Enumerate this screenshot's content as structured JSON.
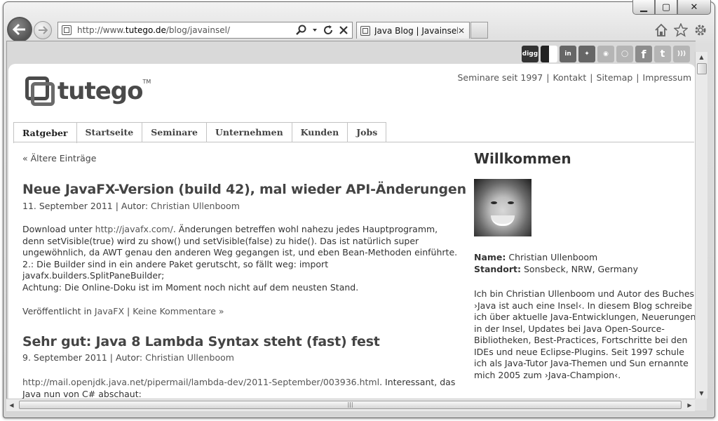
{
  "browser": {
    "url_prefix": "http://www.",
    "url_domain": "tutego.de",
    "url_suffix": "/blog/javainsel/",
    "tab_title": "Java Blog | Javainsel...",
    "tab_close": "✕",
    "caption_minimize": "▁",
    "caption_maximize": "▢",
    "caption_close": "✕"
  },
  "social_icons": [
    "digg",
    "delicious",
    "linkedin",
    "myspace",
    "reddit",
    "chat",
    "facebook",
    "twitter",
    "rss"
  ],
  "site": {
    "logo_text": "tutego",
    "logo_tm": "TM",
    "top_links": [
      "Seminare seit 1997",
      "Kontakt",
      "Sitemap",
      "Impressum"
    ],
    "separator": "|",
    "menu": [
      "Ratgeber",
      "Startseite",
      "Seminare",
      "Unternehmen",
      "Kunden",
      "Jobs"
    ]
  },
  "main": {
    "older_entries": "« Ältere Einträge",
    "post1": {
      "title": "Neue JavaFX-Version (build 42), mal wieder API-Änderungen",
      "date": "11. September 2011",
      "author_label": "Autor:",
      "author": "Christian Ullenboom",
      "intro": "Download unter ",
      "link": "http://javafx.com/",
      "line1_rest": ". Änderungen betreffen wohl nahezu jedes Hauptprogramm,",
      "line2": "denn setVisible(true) wird zu show() und setVisible(false) zu hide(). Das ist natürlich super",
      "line3": "ungewöhnlich, da AWT genau den anderen Weg gegangen ist, und eben Bean-Methoden einführte.",
      "line4": "2.: Die Builder sind in ein andere Paket gerutscht, so fällt weg: import",
      "line5": "javafx.builders.SplitPaneBuilder;",
      "line6": "Achtung: Die Online-Doku ist im Moment noch nicht auf dem neusten Stand.",
      "published_in": "Veröffentlicht in ",
      "category": "JavaFX",
      "comments": "Keine Kommentare »"
    },
    "post2": {
      "title": "Sehr gut: Java 8 Lambda Syntax steht (fast) fest",
      "date": "9. September 2011",
      "author_label": "Autor:",
      "author": "Christian Ullenboom",
      "link": "http://mail.openjdk.java.net/pipermail/lambda-dev/2011-September/003936.html",
      "line1_rest": ". Interessant, das",
      "line2": "Java nun von C# abschaut:"
    }
  },
  "sidebar": {
    "title": "Willkommen",
    "name_label": "Name:",
    "name": "Christian Ullenboom",
    "location_label": "Standort:",
    "location": "Sonsbeck, NRW, Germany",
    "bio": [
      "Ich bin Christian Ullenboom und Autor des Buches",
      "›Java ist auch eine Insel‹. In diesem Blog schreibe",
      "ich über aktuelle Java-Entwicklungen, Neuerungen",
      "in der Insel, Updates bei Java Open-Source-",
      "Bibliotheken, Best-Practices, Fortschritte bei den",
      "IDEs und neue Eclipse-Plugins. Seit 1997 schule",
      "ich als Java-Tutor Java-Themen und Sun ernannte",
      "mich 2005 zum ›Java-Champion‹."
    ]
  }
}
